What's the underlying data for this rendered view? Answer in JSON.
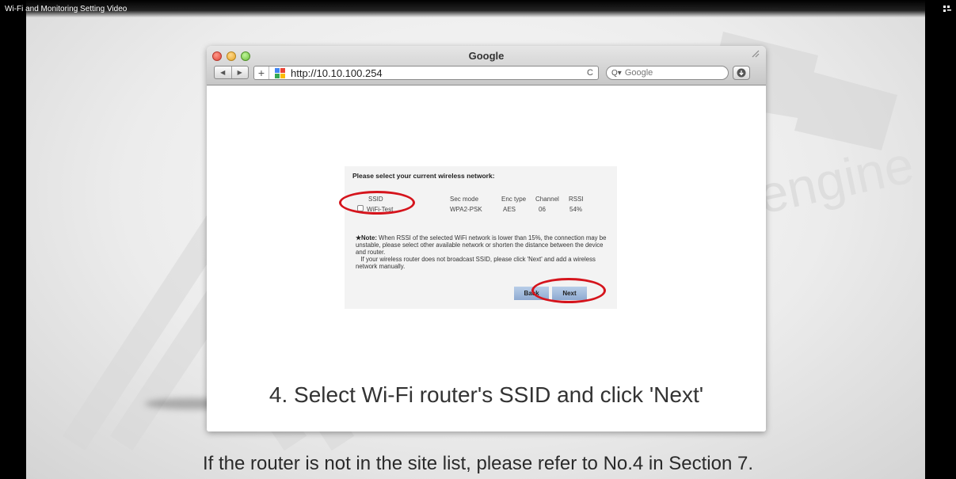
{
  "video": {
    "title": "Wi-Fi and Monitoring Setting Video",
    "subtitle": "If the router is not in the site list, please refer to No.4 in Section 7."
  },
  "watermark": {
    "text": "engine"
  },
  "browser": {
    "window_title": "Google",
    "url": "http://10.10.100.254",
    "search_placeholder": "Google",
    "reload_icon": "C",
    "icons": [
      "close-icon",
      "minimize-icon",
      "maximize-icon",
      "back-arrow-icon",
      "forward-arrow-icon",
      "plus-icon",
      "favicon-icon",
      "reload-icon",
      "search-icon",
      "download-icon",
      "resize-icon"
    ]
  },
  "setup": {
    "heading": "Please select your current wireless network:",
    "columns": [
      "SSID",
      "Sec mode",
      "Enc type",
      "Channel",
      "RSSI"
    ],
    "rows": [
      {
        "ssid": "WiFi-Test",
        "sec_mode": "WPA2-PSK",
        "enc_type": "AES",
        "channel": "06",
        "rssi": "54%"
      }
    ],
    "note_label": "★Note:",
    "note_text": " When RSSI of the selected WiFi network is lower than 15%, the connection may be unstable, please select other available network or shorten the distance between the device and router.",
    "note_text2": "If your wireless router does not broadcast SSID, please click 'Next' and add a wireless network manually.",
    "back_label": "Back",
    "next_label": "Next",
    "highlight_color": "#d5141c"
  },
  "caption": "4. Select Wi-Fi router's SSID and click 'Next'"
}
